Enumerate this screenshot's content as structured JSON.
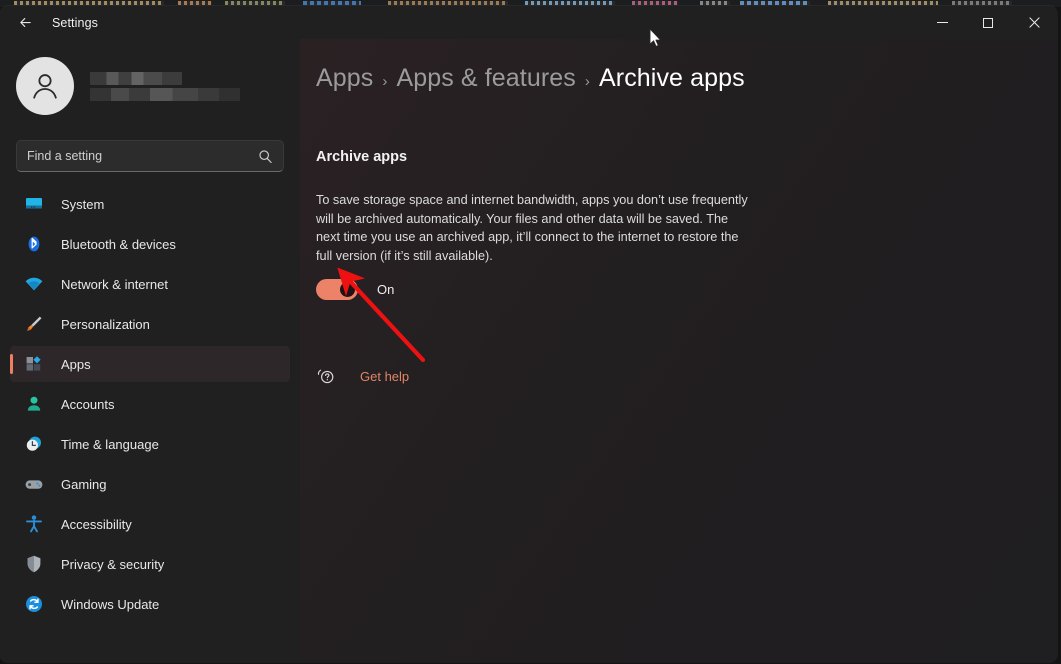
{
  "window": {
    "title": "Settings",
    "back_label": "Back",
    "controls": {
      "minimize": "Minimize",
      "maximize": "Maximize",
      "close": "Close"
    }
  },
  "account": {
    "name_redacted": true
  },
  "search": {
    "placeholder": "Find a setting",
    "value": "",
    "icon": "search-icon"
  },
  "sidebar": {
    "items": [
      {
        "label": "System",
        "icon": "monitor-icon",
        "selected": false
      },
      {
        "label": "Bluetooth & devices",
        "icon": "bluetooth-icon",
        "selected": false
      },
      {
        "label": "Network & internet",
        "icon": "wifi-icon",
        "selected": false
      },
      {
        "label": "Personalization",
        "icon": "paintbrush-icon",
        "selected": false
      },
      {
        "label": "Apps",
        "icon": "apps-icon",
        "selected": true
      },
      {
        "label": "Accounts",
        "icon": "person-icon",
        "selected": false
      },
      {
        "label": "Time & language",
        "icon": "clock-icon",
        "selected": false
      },
      {
        "label": "Gaming",
        "icon": "gamepad-icon",
        "selected": false
      },
      {
        "label": "Accessibility",
        "icon": "accessibility-icon",
        "selected": false
      },
      {
        "label": "Privacy & security",
        "icon": "shield-icon",
        "selected": false
      },
      {
        "label": "Windows Update",
        "icon": "update-icon",
        "selected": false
      }
    ]
  },
  "main": {
    "breadcrumb": [
      {
        "label": "Apps",
        "current": false
      },
      {
        "label": "Apps & features",
        "current": false
      },
      {
        "label": "Archive apps",
        "current": true
      }
    ],
    "breadcrumb_separator": "›",
    "section_title": "Archive apps",
    "description": "To save storage space and internet bandwidth, apps you don’t use frequently will be archived automatically. Your files and other data will be saved. The next time you use an archived app, it’ll connect to the internet to restore the full version (if it’s still available).",
    "toggle": {
      "state_label": "On",
      "checked": true
    },
    "get_help": {
      "label": "Get help",
      "icon": "help-bubble-icon"
    }
  },
  "colors": {
    "accent": "#ec8268",
    "link": "#e08565",
    "annotation_arrow": "#ee1111",
    "window_bg": "#202020",
    "content_bg": "#231f21",
    "selected_nav_bg": "#2d2729"
  },
  "annotation": {
    "type": "arrow",
    "points_to": "archive-apps-toggle"
  }
}
